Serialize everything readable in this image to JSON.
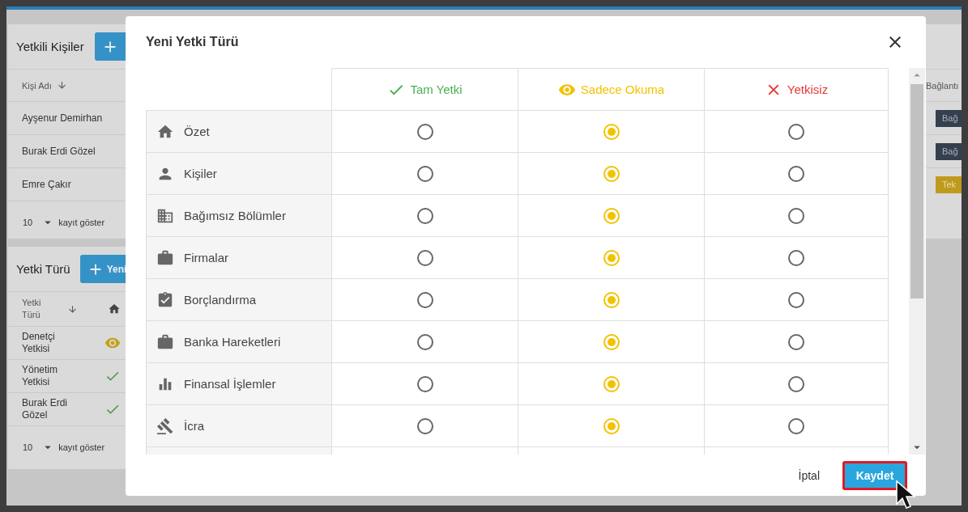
{
  "background": {
    "people_panel": {
      "title": "Yetkili Kişiler",
      "column": "Kişi Adı",
      "rows": [
        {
          "name": "Ayşenur Demirhan"
        },
        {
          "name": "Burak Erdi Gözel"
        },
        {
          "name": "Emre Çakır"
        }
      ],
      "page_size": "10",
      "page_size_label": "kayıt göster"
    },
    "types_panel": {
      "title": "Yetki Türü",
      "add_button": "Yeni",
      "column": "Yetki Türü",
      "rows": [
        {
          "name": "Denetçi Yetkisi",
          "kind": "read"
        },
        {
          "name": "Yönetim Yetkisi",
          "kind": "full"
        },
        {
          "name": "Burak Erdi Gözel",
          "kind": "full"
        }
      ],
      "page_size": "10",
      "page_size_label": "kayıt göster"
    },
    "links_panel": {
      "column": "Bağlantı",
      "buttons": [
        {
          "label": "Bağ",
          "kind": "dark"
        },
        {
          "label": "Bağ",
          "kind": "dark"
        },
        {
          "label": "Tek",
          "kind": "gold"
        }
      ]
    }
  },
  "dialog": {
    "title": "Yeni Yetki Türü",
    "columns": [
      {
        "label": "Tam Yetki",
        "kind": "full"
      },
      {
        "label": "Sadece Okuma",
        "kind": "read"
      },
      {
        "label": "Yetkisiz",
        "kind": "none"
      }
    ],
    "rows": [
      {
        "label": "Özet",
        "options": [
          {
            "selected": false
          },
          {
            "selected": true
          },
          {
            "selected": false
          }
        ]
      },
      {
        "label": "Kişiler",
        "options": [
          {
            "selected": false
          },
          {
            "selected": true
          },
          {
            "selected": false
          }
        ]
      },
      {
        "label": "Bağımsız Bölümler",
        "options": [
          {
            "selected": false
          },
          {
            "selected": true
          },
          {
            "selected": false
          }
        ]
      },
      {
        "label": "Firmalar",
        "options": [
          {
            "selected": false
          },
          {
            "selected": true
          },
          {
            "selected": false
          }
        ]
      },
      {
        "label": "Borçlandırma",
        "options": [
          {
            "selected": false
          },
          {
            "selected": true
          },
          {
            "selected": false
          }
        ]
      },
      {
        "label": "Banka Hareketleri",
        "options": [
          {
            "selected": false
          },
          {
            "selected": true
          },
          {
            "selected": false
          }
        ]
      },
      {
        "label": "Finansal İşlemler",
        "options": [
          {
            "selected": false
          },
          {
            "selected": true
          },
          {
            "selected": false
          }
        ]
      },
      {
        "label": "İcra",
        "options": [
          {
            "selected": false
          },
          {
            "selected": true
          },
          {
            "selected": false
          }
        ]
      }
    ],
    "cancel": "İptal",
    "save": "Kaydet"
  }
}
